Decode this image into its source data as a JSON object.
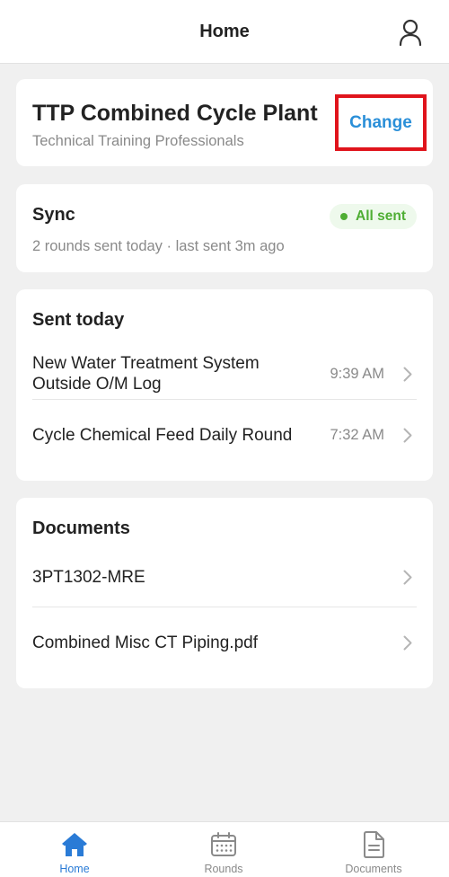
{
  "header": {
    "title": "Home",
    "profile_icon": "user-icon"
  },
  "plant": {
    "name": "TTP Combined Cycle Plant",
    "org": "Technical Training Professionals",
    "change_label": "Change"
  },
  "sync": {
    "title": "Sync",
    "status": "All sent",
    "status_color": "#4fae34",
    "summary": "2 rounds sent today · last sent 3m ago"
  },
  "sent_today": {
    "title": "Sent today",
    "items": [
      {
        "label": "New Water Treatment System Outside O/M Log",
        "time": "9:39 AM"
      },
      {
        "label": "Cycle Chemical Feed Daily Round",
        "time": "7:32 AM"
      }
    ]
  },
  "documents": {
    "title": "Documents",
    "items": [
      {
        "label": "3PT1302-MRE"
      },
      {
        "label": "Combined Misc CT Piping.pdf"
      }
    ]
  },
  "tabs": [
    {
      "label": "Home",
      "icon": "home-icon",
      "active": true
    },
    {
      "label": "Rounds",
      "icon": "calendar-icon",
      "active": false
    },
    {
      "label": "Documents",
      "icon": "document-icon",
      "active": false
    }
  ],
  "colors": {
    "accent": "#2a7bd6",
    "link": "#2a8fd8",
    "highlight": "#e0141c"
  }
}
